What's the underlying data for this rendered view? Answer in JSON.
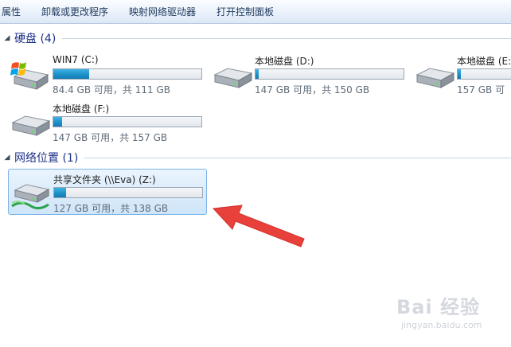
{
  "toolbar": {
    "items": [
      "属性",
      "卸载或更改程序",
      "映射网络驱动器",
      "打开控制面板"
    ]
  },
  "groups": {
    "hard_disks": {
      "title": "硬盘 (4)",
      "toggle": "◢"
    },
    "network": {
      "title": "网络位置 (1)",
      "toggle": "◢"
    }
  },
  "drives": [
    {
      "name": "WIN7 (C:)",
      "info": "84.4 GB 可用，共 111 GB",
      "used_fraction": 0.24,
      "icon": "windows-drive-icon"
    },
    {
      "name": "本地磁盘 (D:)",
      "info": "147 GB 可用，共 150 GB",
      "used_fraction": 0.02,
      "icon": "hard-drive-icon"
    },
    {
      "name": "本地磁盘 (E:",
      "info": "157 GB 可",
      "used_fraction": 0.02,
      "icon": "hard-drive-icon"
    },
    {
      "name": "本地磁盘 (F:)",
      "info": "147 GB 可用，共 157 GB",
      "used_fraction": 0.06,
      "icon": "hard-drive-icon"
    }
  ],
  "network_drives": [
    {
      "name": "共享文件夹 (\\\\Eva) (Z:)",
      "info": "127 GB 可用，共 138 GB",
      "used_fraction": 0.08,
      "icon": "network-drive-icon",
      "selected": true
    }
  ],
  "annotation": {
    "icon": "red-arrow-icon",
    "color": "#e8403a"
  },
  "watermark": {
    "logo": "Bai 经验",
    "url": "jingyan.baidu.com"
  },
  "colors": {
    "accent": "#1e3287",
    "bar": "#1c8ec6",
    "selection": "#cfe5f9"
  }
}
